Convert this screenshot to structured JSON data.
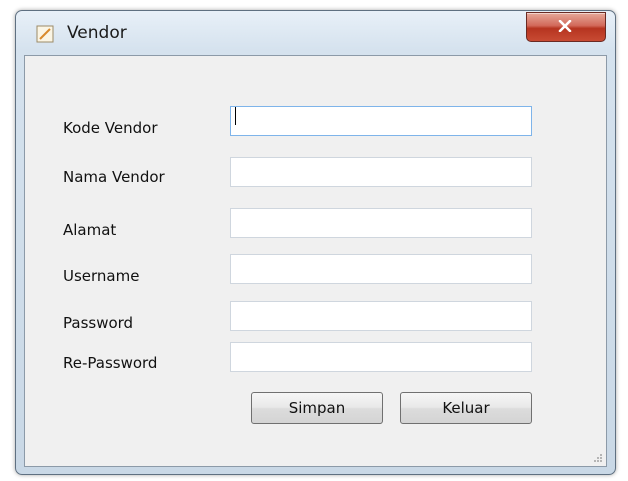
{
  "window": {
    "title": "Vendor",
    "icon": "edit-form-icon",
    "close_icon": "close-icon",
    "close_color": "#c8452f"
  },
  "form": {
    "fields": [
      {
        "label": "Kode Vendor",
        "value": "",
        "focused": true
      },
      {
        "label": "Nama Vendor",
        "value": ""
      },
      {
        "label": "Alamat",
        "value": ""
      },
      {
        "label": "Username",
        "value": ""
      },
      {
        "label": "Password",
        "value": ""
      },
      {
        "label": "Re-Password",
        "value": ""
      }
    ]
  },
  "buttons": {
    "save_label": "Simpan",
    "exit_label": "Keluar"
  }
}
